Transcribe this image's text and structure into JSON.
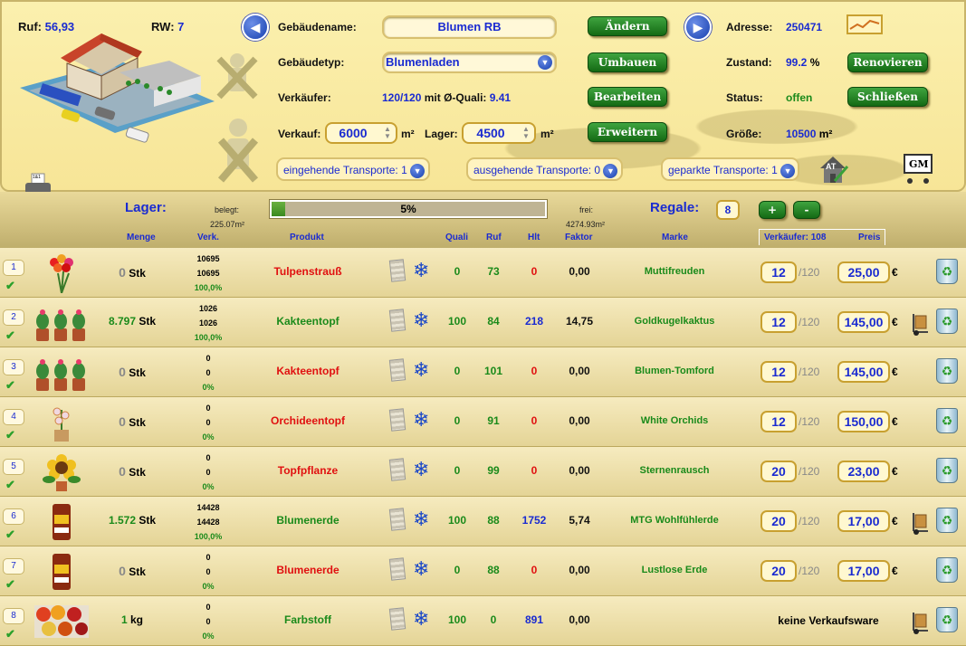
{
  "top": {
    "ruf_label": "Ruf:",
    "ruf_value": "56,93",
    "rw_label": "RW:",
    "rw_value": "7",
    "gebaeudename_label": "Gebäudename:",
    "gebaeudename_value": "Blumen RB",
    "gebaeudetyp_label": "Gebäudetyp:",
    "gebaeudetyp_value": "Blumenladen",
    "verkaeufer_label": "Verkäufer:",
    "verkaeufer_value": "120/120",
    "quali_label": "mit Ø-Quali:",
    "quali_value": "9.41",
    "verkauf_label": "Verkauf:",
    "verkauf_value": "6000",
    "lager_label": "Lager:",
    "lager_value": "4500",
    "unit_m2": "m²",
    "adresse_label": "Adresse:",
    "adresse_value": "250471",
    "zustand_label": "Zustand:",
    "zustand_value": "99.2",
    "zustand_unit": "%",
    "status_label": "Status:",
    "status_value": "offen",
    "groesse_label": "Größe:",
    "groesse_value": "10500",
    "buttons": {
      "aendern": "Ändern",
      "umbauen": "Umbauen",
      "bearbeiten": "Bearbeiten",
      "erweitern": "Erweitern",
      "renovieren": "Renovieren",
      "schliessen": "Schließen"
    },
    "transports": {
      "eingehend": "eingehende Transporte: 1",
      "ausgehend": "ausgehende Transporte: 0",
      "geparkt": "geparkte Transporte: 1"
    },
    "at_label": "AT",
    "gm_label": "GM",
    "register_label": "1&1"
  },
  "lager": {
    "title": "Lager:",
    "belegt_label": "belegt:",
    "belegt_value": "225.07m²",
    "progress_text": "5%",
    "progress_fraction": 0.05,
    "frei_label": "frei:",
    "frei_value": "4274.93m²",
    "regale_label": "Regale:",
    "regale_value": "8",
    "plus": "+",
    "minus": "-"
  },
  "columns": {
    "menge": "Menge",
    "verk": "Verk.",
    "produkt": "Produkt",
    "quali": "Quali",
    "ruf": "Ruf",
    "hlt": "Hlt",
    "faktor": "Faktor",
    "marke": "Marke",
    "verkaeufer": "Verkäufer: 108",
    "preis": "Preis"
  },
  "rows": [
    {
      "num": "1",
      "qty": "0",
      "unit": "Stk",
      "v1": "10695",
      "v2": "10695",
      "pct": "100,0%",
      "product": "Tulpenstrauß",
      "quali": "0",
      "ruf": "73",
      "hlt": "0",
      "faktor": "0,00",
      "marke": "Muttifreuden",
      "sellers": "12",
      "sellers_max": "/120",
      "price": "25,00",
      "currency": "€",
      "image": "tulip-bouquet",
      "cart": false,
      "active": false,
      "keine": ""
    },
    {
      "num": "2",
      "qty": "8.797",
      "unit": "Stk",
      "v1": "1026",
      "v2": "1026",
      "pct": "100,0%",
      "product": "Kakteentopf",
      "quali": "100",
      "ruf": "84",
      "hlt": "218",
      "faktor": "14,75",
      "marke": "Goldkugelkaktus",
      "sellers": "12",
      "sellers_max": "/120",
      "price": "145,00",
      "currency": "€",
      "image": "cactus-pots",
      "cart": true,
      "active": true,
      "keine": ""
    },
    {
      "num": "3",
      "qty": "0",
      "unit": "Stk",
      "v1": "0",
      "v2": "0",
      "pct": "0%",
      "product": "Kakteentopf",
      "quali": "0",
      "ruf": "101",
      "hlt": "0",
      "faktor": "0,00",
      "marke": "Blumen-Tomford",
      "sellers": "12",
      "sellers_max": "/120",
      "price": "145,00",
      "currency": "€",
      "image": "cactus-pots",
      "cart": false,
      "active": false,
      "keine": ""
    },
    {
      "num": "4",
      "qty": "0",
      "unit": "Stk",
      "v1": "0",
      "v2": "0",
      "pct": "0%",
      "product": "Orchideentopf",
      "quali": "0",
      "ruf": "91",
      "hlt": "0",
      "faktor": "0,00",
      "marke": "White Orchids",
      "sellers": "12",
      "sellers_max": "/120",
      "price": "150,00",
      "currency": "€",
      "image": "orchid-pot",
      "cart": false,
      "active": false,
      "keine": ""
    },
    {
      "num": "5",
      "qty": "0",
      "unit": "Stk",
      "v1": "0",
      "v2": "0",
      "pct": "0%",
      "product": "Topfpflanze",
      "quali": "0",
      "ruf": "99",
      "hlt": "0",
      "faktor": "0,00",
      "marke": "Sternenrausch",
      "sellers": "20",
      "sellers_max": "/120",
      "price": "23,00",
      "currency": "€",
      "image": "sunflower",
      "cart": false,
      "active": false,
      "keine": ""
    },
    {
      "num": "6",
      "qty": "1.572",
      "unit": "Stk",
      "v1": "14428",
      "v2": "14428",
      "pct": "100,0%",
      "product": "Blumenerde",
      "quali": "100",
      "ruf": "88",
      "hlt": "1752",
      "faktor": "5,74",
      "marke": "MTG Wohlfühlerde",
      "sellers": "20",
      "sellers_max": "/120",
      "price": "17,00",
      "currency": "€",
      "image": "soil-bag",
      "cart": true,
      "active": true,
      "keine": ""
    },
    {
      "num": "7",
      "qty": "0",
      "unit": "Stk",
      "v1": "0",
      "v2": "0",
      "pct": "0%",
      "product": "Blumenerde",
      "quali": "0",
      "ruf": "88",
      "hlt": "0",
      "faktor": "0,00",
      "marke": "Lustlose Erde",
      "sellers": "20",
      "sellers_max": "/120",
      "price": "17,00",
      "currency": "€",
      "image": "soil-bag",
      "cart": false,
      "active": false,
      "keine": ""
    },
    {
      "num": "8",
      "qty": "1",
      "unit": "kg",
      "v1": "0",
      "v2": "0",
      "pct": "0%",
      "product": "Farbstoff",
      "quali": "100",
      "ruf": "0",
      "hlt": "891",
      "faktor": "0,00",
      "marke": "",
      "sellers": "",
      "sellers_max": "",
      "price": "",
      "currency": "",
      "image": "dye-powders",
      "cart": true,
      "active": true,
      "keine": "keine Verkaufsware"
    }
  ],
  "colors": {
    "green": "#1a8a1a",
    "red": "#e01010",
    "blue": "#1a2bd1"
  }
}
